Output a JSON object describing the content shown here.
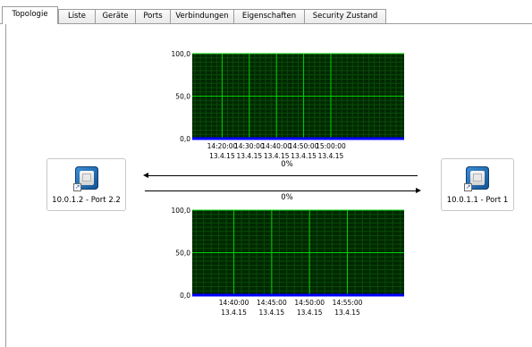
{
  "tabs": [
    {
      "label": "Topologie",
      "active": true
    },
    {
      "label": "Liste",
      "active": false
    },
    {
      "label": "Geräte",
      "active": false
    },
    {
      "label": "Ports",
      "active": false
    },
    {
      "label": "Verbindungen",
      "active": false
    },
    {
      "label": "Eigenschaften",
      "active": false
    },
    {
      "label": "Security Zustand",
      "active": false
    }
  ],
  "left_node": {
    "label": "10.0.1.2 - Port 2.2",
    "icon": "network-port-icon"
  },
  "right_node": {
    "label": "10.0.1.1 - Port 1",
    "icon": "network-port-icon"
  },
  "links": {
    "left_arrow_percent": "0%",
    "right_arrow_percent": "0%"
  },
  "colors": {
    "plot_bg": "#002800",
    "grid_major": "#00d000",
    "grid_minor": "#0a4a0a",
    "series": "#0000ff",
    "tab_border": "#9c9c9c"
  },
  "chart_data": [
    {
      "type": "area",
      "title": "",
      "ylim": [
        0,
        100
      ],
      "y_ticks": [
        "100,0",
        "50,0",
        "0,0"
      ],
      "x_ticks": [
        {
          "time": "14:20:00",
          "date": "13.4.15"
        },
        {
          "time": "14:30:00",
          "date": "13.4.15"
        },
        {
          "time": "14:40:00",
          "date": "13.4.15"
        },
        {
          "time": "14:50:00",
          "date": "13.4.15"
        },
        {
          "time": "15:00:00",
          "date": "13.4.15"
        }
      ],
      "x_range_minutes": [
        -11,
        67
      ],
      "series": [
        {
          "values": [
            0,
            0,
            0,
            0,
            0
          ]
        }
      ]
    },
    {
      "type": "area",
      "title": "",
      "ylim": [
        0,
        100
      ],
      "y_ticks": [
        "100,0",
        "50,0",
        "0,0"
      ],
      "x_ticks": [
        {
          "time": "14:40:00",
          "date": "13.4.15"
        },
        {
          "time": "14:45:00",
          "date": "13.4.15"
        },
        {
          "time": "14:50:00",
          "date": "13.4.15"
        },
        {
          "time": "14:55:00",
          "date": "13.4.15"
        }
      ],
      "x_range_minutes": [
        -5.5,
        22.5
      ],
      "series": [
        {
          "values": [
            0,
            0,
            0,
            0
          ]
        }
      ]
    }
  ]
}
